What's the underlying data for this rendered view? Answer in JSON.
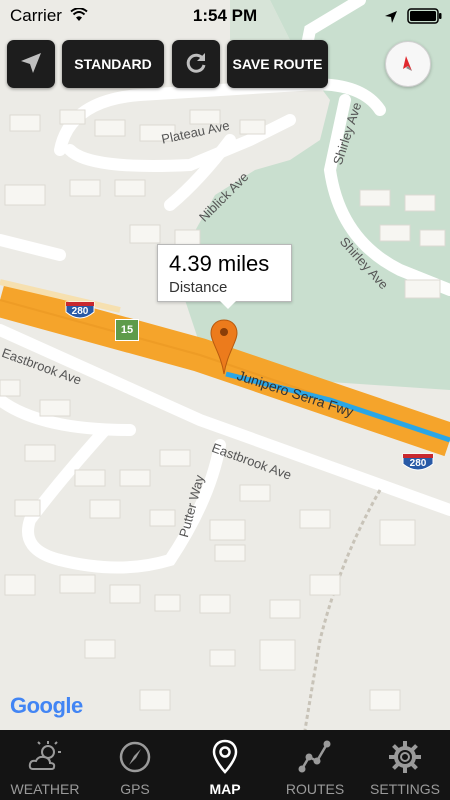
{
  "status_bar": {
    "carrier": "Carrier",
    "time": "1:54 PM"
  },
  "toolbar": {
    "map_type_label": "STANDARD",
    "save_route_label": "SAVE ROUTE"
  },
  "callout": {
    "value": "4.39 miles",
    "label": "Distance"
  },
  "map": {
    "attribution": "Google",
    "road_labels": {
      "plateau": "Plateau Ave",
      "niblick": "Niblick Ave",
      "shirley_top": "Shirley Ave",
      "shirley_bottom": "Shirley Ave",
      "eastbrook_left": "Eastbrook Ave",
      "eastbrook_right": "Eastbrook Ave",
      "junipero": "Junipero Serra Fwy",
      "putter": "Putter Way"
    },
    "shields": {
      "i280_left": "280",
      "i280_right": "280",
      "route15": "15"
    }
  },
  "tabs": [
    {
      "label": "WEATHER",
      "icon": "weather-icon",
      "active": false
    },
    {
      "label": "GPS",
      "icon": "gps-compass-icon",
      "active": false
    },
    {
      "label": "MAP",
      "icon": "map-pin-icon",
      "active": true
    },
    {
      "label": "ROUTES",
      "icon": "routes-icon",
      "active": false
    },
    {
      "label": "SETTINGS",
      "icon": "settings-gear-icon",
      "active": false
    }
  ],
  "colors": {
    "freeway": "#f5a42b",
    "route_line": "#2aa6e6",
    "park": "#c9dfcf",
    "pin": "#ec7b1c",
    "tabbar": "#141414"
  }
}
